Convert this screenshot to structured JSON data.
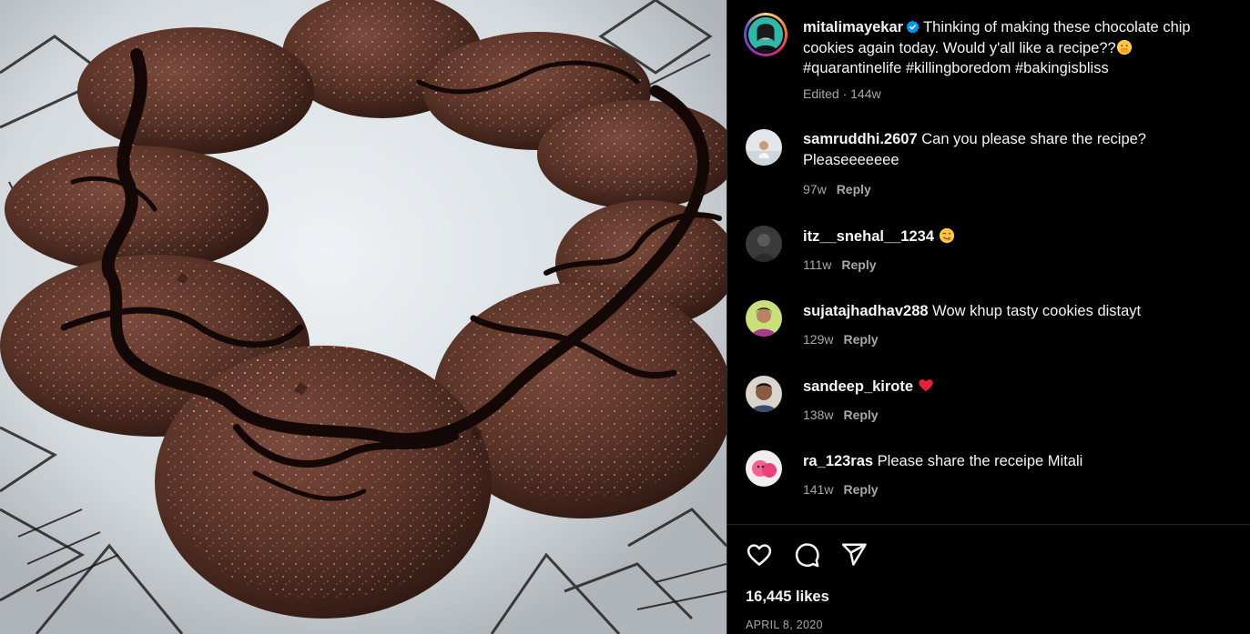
{
  "post": {
    "image_alt": "Chocolate chip cookies drizzled with chocolate sauce on a decorated plate",
    "author": {
      "username": "mitalimayekar",
      "verified": true,
      "avatar_icon": "profile-avatar"
    },
    "caption": {
      "text": "Thinking of making these chocolate chip cookies again today. Would y'all like a recipe??",
      "emoji": "hand-over-mouth-emoji",
      "hashtags": "#quarantinelife #killingboredom #bakingisbliss"
    },
    "edited_meta": "Edited · 144w"
  },
  "comments": [
    {
      "username": "samruddhi.2607",
      "text": "Can you please share the recipe? Pleaseeeeeee",
      "emoji": "",
      "age": "97w",
      "reply_label": "Reply"
    },
    {
      "username": "itz__snehal__1234",
      "text": "",
      "emoji": "yum-face-emoji",
      "age": "111w",
      "reply_label": "Reply"
    },
    {
      "username": "sujatajhadhav288",
      "text": "Wow khup tasty cookies distayt",
      "emoji": "",
      "age": "129w",
      "reply_label": "Reply"
    },
    {
      "username": "sandeep_kirote",
      "text": "",
      "emoji": "red-heart-emoji",
      "age": "138w",
      "reply_label": "Reply"
    },
    {
      "username": "ra_123ras",
      "text": "Please share the receipe Mitali",
      "emoji": "",
      "age": "141w",
      "reply_label": "Reply"
    }
  ],
  "actions": {
    "like_icon": "heart-icon",
    "comment_icon": "comment-icon",
    "share_icon": "share-icon"
  },
  "likes": "16,445 likes",
  "date": "APRIL 8, 2020",
  "colors": {
    "background": "#000000",
    "text": "#f5f5f5",
    "muted": "#a8a8a8",
    "verified": "#0095f6",
    "divider": "#262626"
  }
}
